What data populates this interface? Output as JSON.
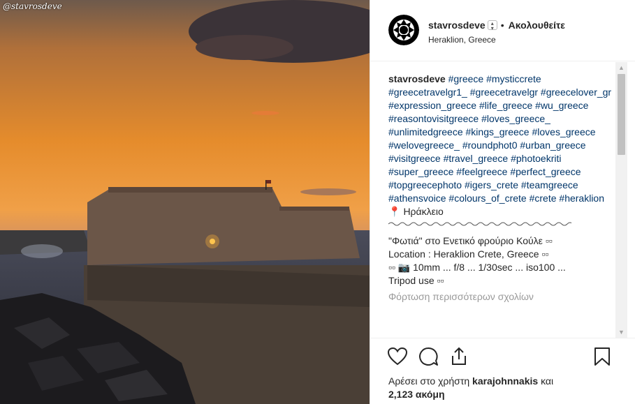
{
  "photo": {
    "watermark": "@stavrosdeve"
  },
  "post": {
    "username": "stavrosdeve",
    "separator": "•",
    "follow_label": "Ακολουθείτε",
    "location": "Heraklion, Greece"
  },
  "caption": {
    "username": "stavrosdeve",
    "hashtags": [
      "#greece",
      "#mysticcrete",
      "#greecetravelgr1_",
      "#greecetravelgr",
      "#greecelover_gr",
      "#expression_greece",
      "#life_greece",
      "#wu_greece",
      "#reasontovisitgreece",
      "#loves_greece_",
      "#unlimitedgreece",
      "#kings_greece",
      "#loves_greece",
      "#welovegreece_",
      "#roundphot0",
      "#urban_greece",
      "#visitgreece",
      "#travel_greece",
      "#photoekriti",
      "#super_greece",
      "#feelgreece",
      "#perfect_greece",
      "#topgreecephoto",
      "#igers_crete",
      "#teamgreece",
      "#athensvoice",
      "#colours_of_crete",
      "#crete",
      "#heraklion"
    ],
    "place": "Ηράκλειο",
    "line1": "\"Φωτιά\" στο Ενετικό φρούριο Κούλε ▫▫",
    "line2": "Location : Heraklion Crete, Greece ▫▫",
    "line3": "▫▫ 📷 10mm ... f/8 ... 1/30sec ... iso100 ...",
    "line4": "Tripod use ▫▫",
    "load_more": "Φόρτωση περισσότερων σχολίων"
  },
  "likes": {
    "prefix": "Αρέσει στο χρήστη",
    "liker": "karajohnnakis",
    "conj": "και",
    "count": "2,123 ακόμη"
  },
  "colors": {
    "hashtag": "#003569",
    "text": "#262626",
    "muted": "#999999"
  }
}
